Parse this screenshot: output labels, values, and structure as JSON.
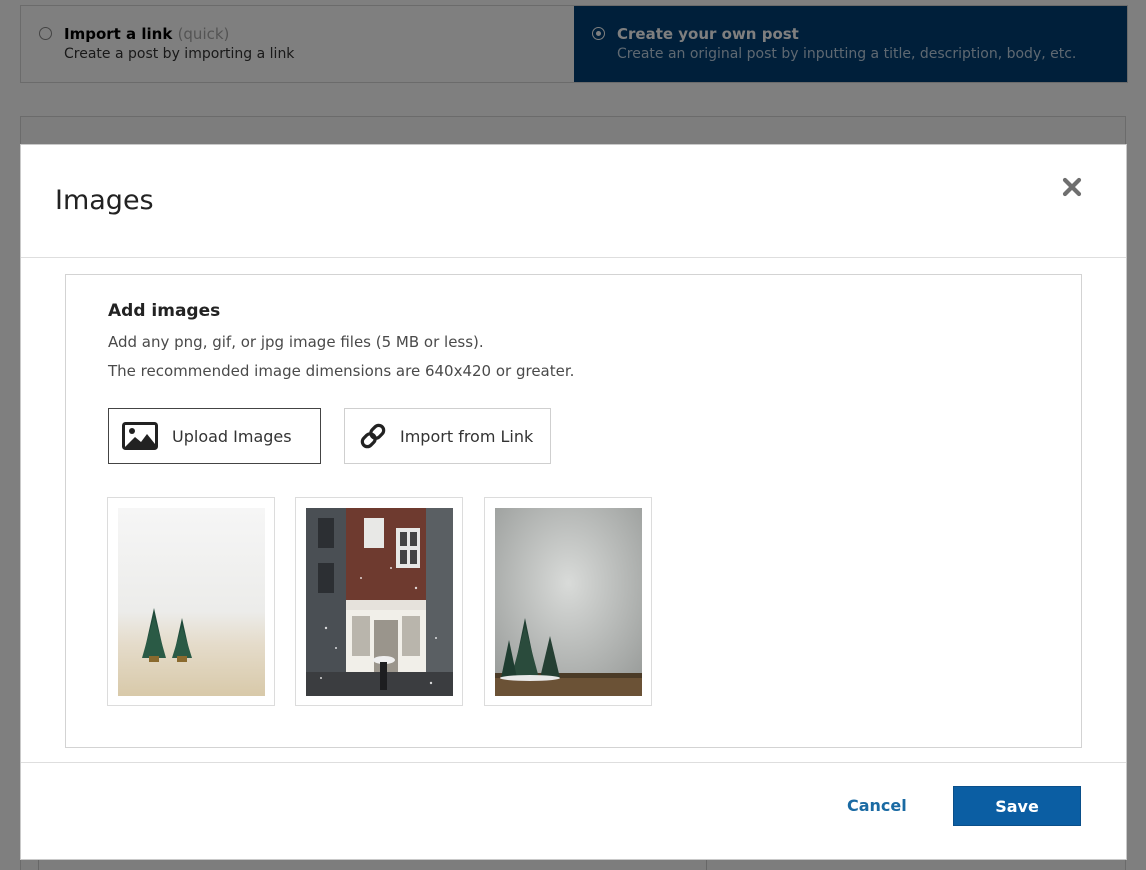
{
  "post_type_options": {
    "import": {
      "title": "Import a link",
      "hint": "(quick)",
      "description": "Create a post by importing a link"
    },
    "create": {
      "title": "Create your own post",
      "description": "Create an original post by inputting a title, description, body, etc.",
      "selected": true
    }
  },
  "modal": {
    "title": "Images",
    "close_icon": "close-icon",
    "section_heading": "Add images",
    "help_text_1": "Add any png, gif, or jpg image files (5 MB or less).",
    "help_text_2": "The recommended image dimensions are 640x420 or greater.",
    "upload_button": {
      "label": "Upload Images",
      "icon": "image-icon"
    },
    "import_button": {
      "label": "Import from Link",
      "icon": "link-icon"
    },
    "thumbnails": [
      {
        "name": "image-thumbnail-trees-on-table"
      },
      {
        "name": "image-thumbnail-snowy-storefront"
      },
      {
        "name": "image-thumbnail-trees-concrete-wall"
      }
    ],
    "cancel_label": "Cancel",
    "save_label": "Save"
  },
  "colors": {
    "selected_option_bg": "#003f74",
    "primary_button": "#0b5ea3",
    "link_text": "#1a6aa3"
  }
}
